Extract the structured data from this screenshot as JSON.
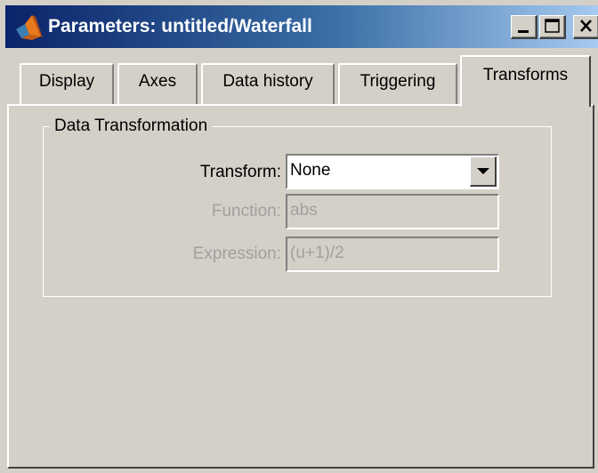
{
  "window": {
    "title": "Parameters: untitled/Waterfall",
    "icon": "matlab-logo-icon",
    "controls": [
      "minimize-icon",
      "maximize-icon",
      "close-icon"
    ]
  },
  "tabs": [
    {
      "label": "Display",
      "active": false
    },
    {
      "label": "Axes",
      "active": false
    },
    {
      "label": "Data history",
      "active": false
    },
    {
      "label": "Triggering",
      "active": false
    },
    {
      "label": "Transforms",
      "active": true
    }
  ],
  "group": {
    "title": "Data Transformation",
    "transform": {
      "label": "Transform:",
      "value": "None",
      "enabled": true
    },
    "function": {
      "label": "Function:",
      "value": "abs",
      "enabled": false
    },
    "expression": {
      "label": "Expression:",
      "value": "(u+1)/2",
      "enabled": false
    }
  },
  "colors": {
    "titlebar_start": "#0a246a",
    "titlebar_end": "#a6caf0",
    "face": "#d4d0c8",
    "disabled_text": "#a0a0a0"
  }
}
